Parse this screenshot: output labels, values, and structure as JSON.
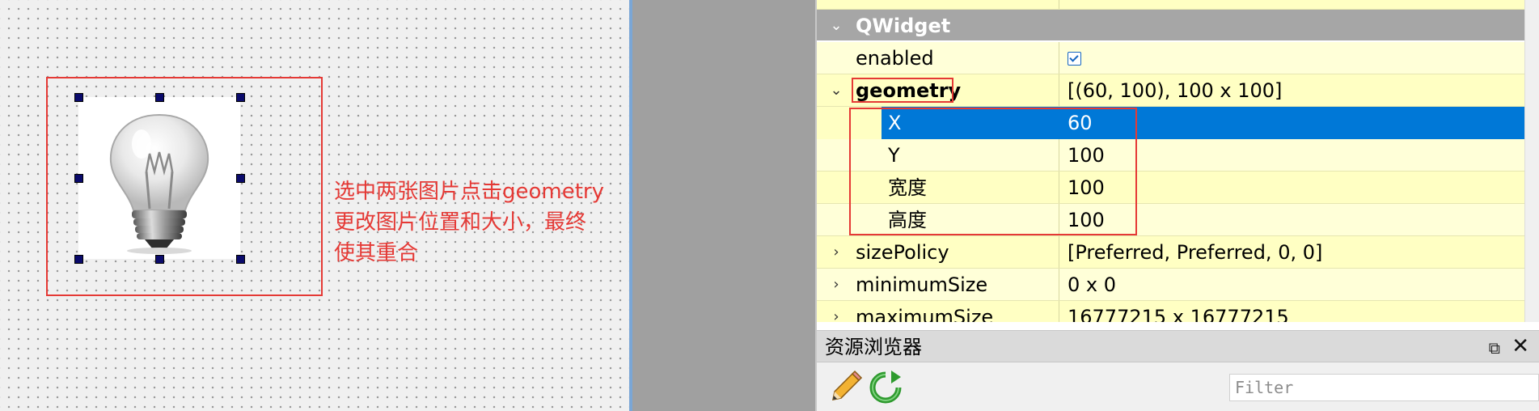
{
  "canvas": {
    "annotation_lines": [
      "选中两张图片点击geometry",
      "更改图片位置和大小，最终",
      "使其重合"
    ],
    "image_icon": "light-bulb-icon"
  },
  "property_editor": {
    "section": {
      "expander": "⌄",
      "label": "QWidget"
    },
    "rows": {
      "enabled": {
        "name": "enabled",
        "checked": true
      },
      "geometry": {
        "expander": "⌄",
        "name": "geometry",
        "value": "[(60, 100), 100 x 100]"
      },
      "x": {
        "name": "X",
        "value": "60"
      },
      "y": {
        "name": "Y",
        "value": "100"
      },
      "width": {
        "name": "宽度",
        "value": "100"
      },
      "height": {
        "name": "高度",
        "value": "100"
      },
      "sizePolicy": {
        "expander": "›",
        "name": "sizePolicy",
        "value": "[Preferred, Preferred, 0, 0]"
      },
      "minimumSize": {
        "expander": "›",
        "name": "minimumSize",
        "value": "0 x 0"
      },
      "maximumSize": {
        "expander": "›",
        "name": "maximumSize",
        "value": "16777215 x 16777215"
      }
    },
    "colors": {
      "row_bg": "#ffffc3",
      "section_bg": "#a6a6a6",
      "selection": "#0078d7",
      "annotation": "#e53935"
    }
  },
  "resource_browser": {
    "title": "资源浏览器",
    "float_icon": "⧉",
    "close_icon": "✕",
    "tools": [
      "pencil-icon",
      "reload-icon"
    ],
    "filter_placeholder": "Filter"
  }
}
